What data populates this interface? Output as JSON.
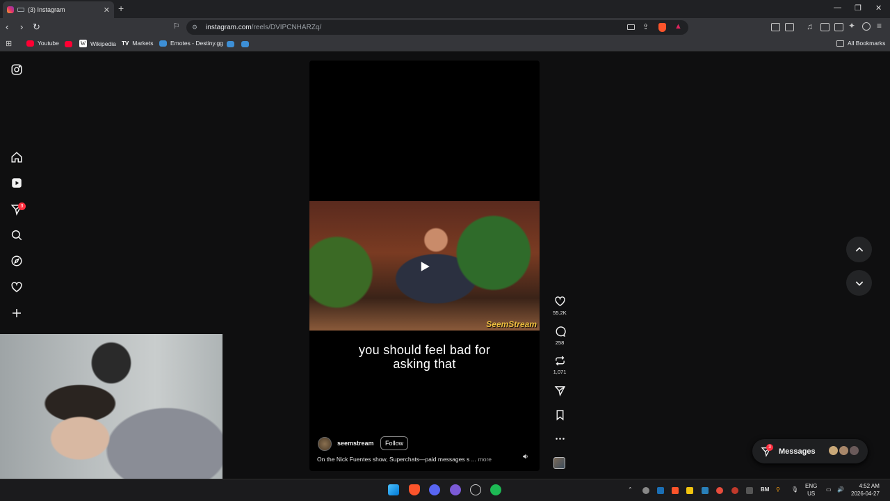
{
  "browser": {
    "tab_title": "(3) Instagram",
    "url_host": "instagram.com",
    "url_path": "/reels/DVIPCNHARZq/",
    "bookmarks": [
      "Youtube",
      "Wikipedia",
      "Markets",
      "Emotes - Destiny.gg"
    ],
    "all_bookmarks": "All Bookmarks",
    "new_tab": "+",
    "close": "✕"
  },
  "sidebar": {
    "notification_count": "3"
  },
  "reel": {
    "watermark": "SeemStream",
    "caption_line1": "you should feel bad for",
    "caption_line2": "asking that",
    "author": "seemstream",
    "follow_label": "Follow",
    "description": "On the Nick Fuentes show, Superchats—paid messages s ...",
    "more_label": "more"
  },
  "actions": {
    "likes": "55.2K",
    "comments": "258",
    "reposts": "1,071"
  },
  "messages": {
    "label": "Messages",
    "badge": "3"
  },
  "taskbar": {
    "lang_line1": "ENG",
    "lang_line2": "US",
    "time": "4:52 AM",
    "date": "2026-04-27",
    "bm_label": "BM"
  },
  "colors": {
    "accent_badge": "#ff3040",
    "background": "#0f0f10",
    "watermark": "#f0c040"
  }
}
